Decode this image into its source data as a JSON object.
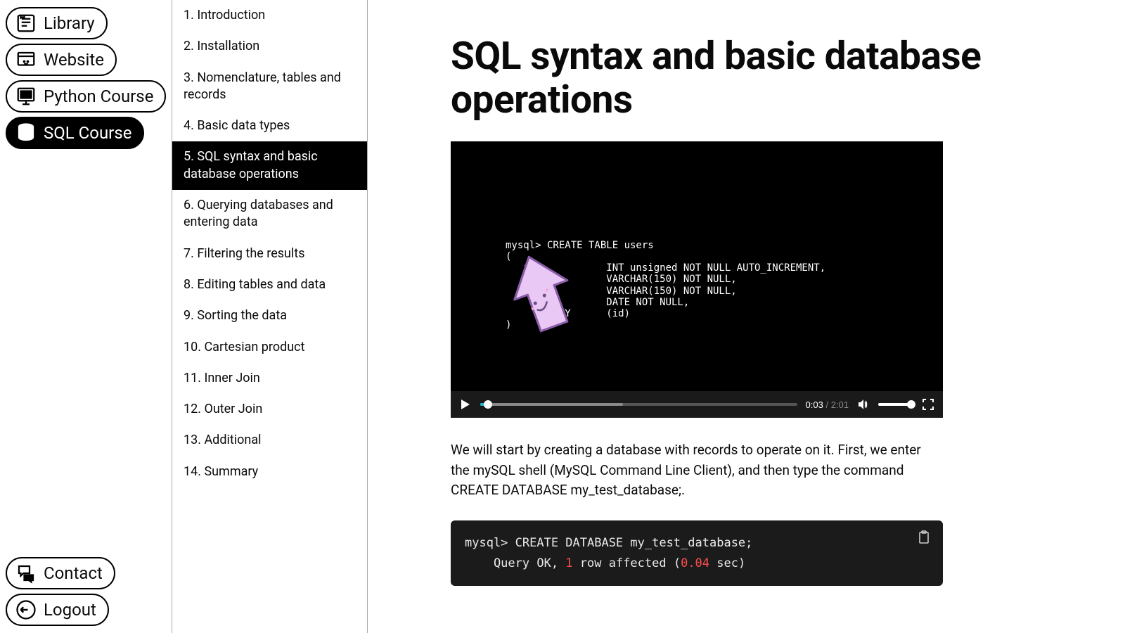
{
  "nav": {
    "items": [
      {
        "label": "Library",
        "icon": "library"
      },
      {
        "label": "Website",
        "icon": "website"
      },
      {
        "label": "Python Course",
        "icon": "desktop"
      },
      {
        "label": "SQL Course",
        "icon": "database",
        "active": true
      }
    ],
    "bottom": [
      {
        "label": "Contact",
        "icon": "chat"
      },
      {
        "label": "Logout",
        "icon": "logout"
      }
    ]
  },
  "toc": {
    "items": [
      "1. Introduction",
      "2. Installation",
      "3. Nomenclature, tables and records",
      "4. Basic data types",
      "5. SQL syntax and basic database operations",
      "6. Querying databases and entering data",
      "7. Filtering the results",
      "8. Editing tables and data",
      "9. Sorting the data",
      "10. Cartesian product",
      "11. Inner Join",
      "12. Outer Join",
      "13. Additional",
      "14. Summary"
    ],
    "active_index": 4
  },
  "content": {
    "title": "SQL syntax and basic database operations",
    "video": {
      "term_lines": [
        "mysql> CREATE TABLE users",
        "(",
        "   id            INT unsigned NOT NULL AUTO_INCREMENT,",
        "                 VARCHAR(150) NOT NULL,",
        "                 VARCHAR(150) NOT NULL,",
        "                 DATE NOT NULL,",
        "        KEY      (id)",
        ")"
      ],
      "current_time": "0:03",
      "duration": "2:01"
    },
    "paragraph": "We will start by creating a database with records to operate on it. First, we enter the mySQL shell (MySQL Command Line Client), and then type the command CREATE DATABASE my_test_database;.",
    "code": {
      "line1": "mysql> CREATE DATABASE my_test_database;",
      "line2_pre": "    Query OK, ",
      "line2_num": "1",
      "line2_mid": " row affected (",
      "line2_time": "0.04",
      "line2_post": " sec)"
    }
  }
}
